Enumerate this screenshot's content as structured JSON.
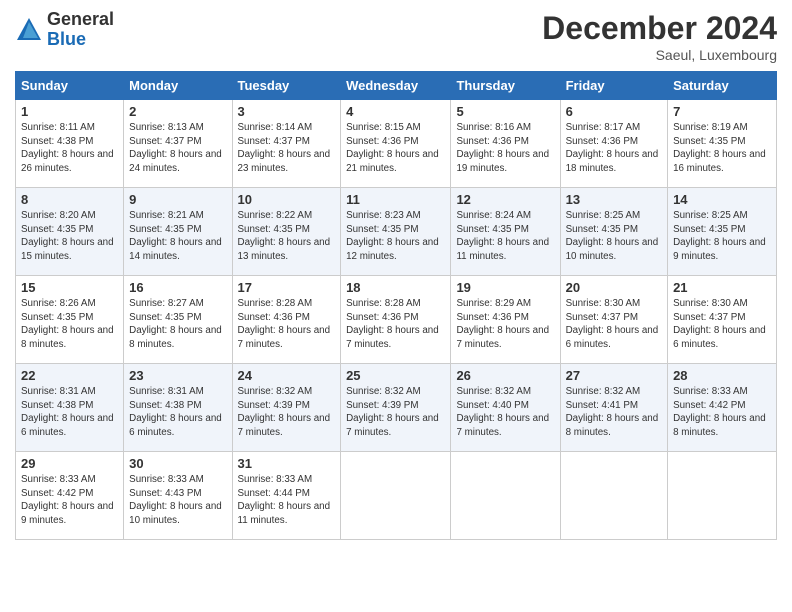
{
  "logo": {
    "general": "General",
    "blue": "Blue"
  },
  "title": "December 2024",
  "location": "Saeul, Luxembourg",
  "weekdays": [
    "Sunday",
    "Monday",
    "Tuesday",
    "Wednesday",
    "Thursday",
    "Friday",
    "Saturday"
  ],
  "weeks": [
    [
      {
        "day": "1",
        "sunrise": "8:11 AM",
        "sunset": "4:38 PM",
        "daylight": "8 hours and 26 minutes."
      },
      {
        "day": "2",
        "sunrise": "8:13 AM",
        "sunset": "4:37 PM",
        "daylight": "8 hours and 24 minutes."
      },
      {
        "day": "3",
        "sunrise": "8:14 AM",
        "sunset": "4:37 PM",
        "daylight": "8 hours and 23 minutes."
      },
      {
        "day": "4",
        "sunrise": "8:15 AM",
        "sunset": "4:36 PM",
        "daylight": "8 hours and 21 minutes."
      },
      {
        "day": "5",
        "sunrise": "8:16 AM",
        "sunset": "4:36 PM",
        "daylight": "8 hours and 19 minutes."
      },
      {
        "day": "6",
        "sunrise": "8:17 AM",
        "sunset": "4:36 PM",
        "daylight": "8 hours and 18 minutes."
      },
      {
        "day": "7",
        "sunrise": "8:19 AM",
        "sunset": "4:35 PM",
        "daylight": "8 hours and 16 minutes."
      }
    ],
    [
      {
        "day": "8",
        "sunrise": "8:20 AM",
        "sunset": "4:35 PM",
        "daylight": "8 hours and 15 minutes."
      },
      {
        "day": "9",
        "sunrise": "8:21 AM",
        "sunset": "4:35 PM",
        "daylight": "8 hours and 14 minutes."
      },
      {
        "day": "10",
        "sunrise": "8:22 AM",
        "sunset": "4:35 PM",
        "daylight": "8 hours and 13 minutes."
      },
      {
        "day": "11",
        "sunrise": "8:23 AM",
        "sunset": "4:35 PM",
        "daylight": "8 hours and 12 minutes."
      },
      {
        "day": "12",
        "sunrise": "8:24 AM",
        "sunset": "4:35 PM",
        "daylight": "8 hours and 11 minutes."
      },
      {
        "day": "13",
        "sunrise": "8:25 AM",
        "sunset": "4:35 PM",
        "daylight": "8 hours and 10 minutes."
      },
      {
        "day": "14",
        "sunrise": "8:25 AM",
        "sunset": "4:35 PM",
        "daylight": "8 hours and 9 minutes."
      }
    ],
    [
      {
        "day": "15",
        "sunrise": "8:26 AM",
        "sunset": "4:35 PM",
        "daylight": "8 hours and 8 minutes."
      },
      {
        "day": "16",
        "sunrise": "8:27 AM",
        "sunset": "4:35 PM",
        "daylight": "8 hours and 8 minutes."
      },
      {
        "day": "17",
        "sunrise": "8:28 AM",
        "sunset": "4:36 PM",
        "daylight": "8 hours and 7 minutes."
      },
      {
        "day": "18",
        "sunrise": "8:28 AM",
        "sunset": "4:36 PM",
        "daylight": "8 hours and 7 minutes."
      },
      {
        "day": "19",
        "sunrise": "8:29 AM",
        "sunset": "4:36 PM",
        "daylight": "8 hours and 7 minutes."
      },
      {
        "day": "20",
        "sunrise": "8:30 AM",
        "sunset": "4:37 PM",
        "daylight": "8 hours and 6 minutes."
      },
      {
        "day": "21",
        "sunrise": "8:30 AM",
        "sunset": "4:37 PM",
        "daylight": "8 hours and 6 minutes."
      }
    ],
    [
      {
        "day": "22",
        "sunrise": "8:31 AM",
        "sunset": "4:38 PM",
        "daylight": "8 hours and 6 minutes."
      },
      {
        "day": "23",
        "sunrise": "8:31 AM",
        "sunset": "4:38 PM",
        "daylight": "8 hours and 6 minutes."
      },
      {
        "day": "24",
        "sunrise": "8:32 AM",
        "sunset": "4:39 PM",
        "daylight": "8 hours and 7 minutes."
      },
      {
        "day": "25",
        "sunrise": "8:32 AM",
        "sunset": "4:39 PM",
        "daylight": "8 hours and 7 minutes."
      },
      {
        "day": "26",
        "sunrise": "8:32 AM",
        "sunset": "4:40 PM",
        "daylight": "8 hours and 7 minutes."
      },
      {
        "day": "27",
        "sunrise": "8:32 AM",
        "sunset": "4:41 PM",
        "daylight": "8 hours and 8 minutes."
      },
      {
        "day": "28",
        "sunrise": "8:33 AM",
        "sunset": "4:42 PM",
        "daylight": "8 hours and 8 minutes."
      }
    ],
    [
      {
        "day": "29",
        "sunrise": "8:33 AM",
        "sunset": "4:42 PM",
        "daylight": "8 hours and 9 minutes."
      },
      {
        "day": "30",
        "sunrise": "8:33 AM",
        "sunset": "4:43 PM",
        "daylight": "8 hours and 10 minutes."
      },
      {
        "day": "31",
        "sunrise": "8:33 AM",
        "sunset": "4:44 PM",
        "daylight": "8 hours and 11 minutes."
      },
      null,
      null,
      null,
      null
    ]
  ]
}
